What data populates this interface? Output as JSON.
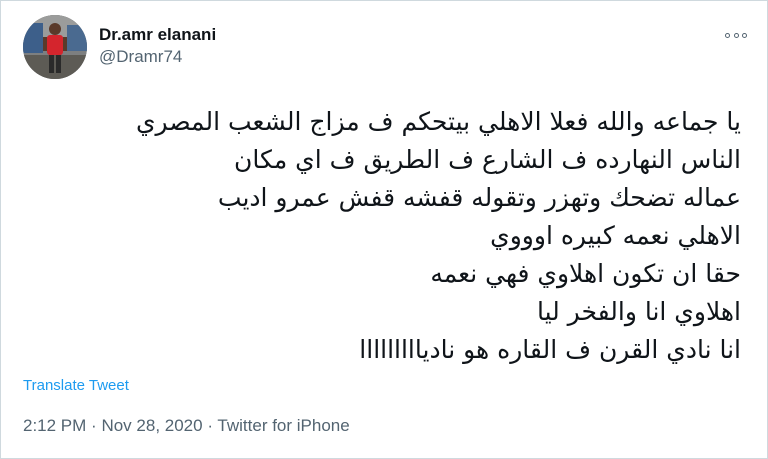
{
  "tweet": {
    "author": {
      "display_name": "Dr.amr elanani",
      "handle": "@Dramr74"
    },
    "more_icon": "more-horizontal-icon",
    "text_lines": [
      "يا جماعه والله فعلا الاهلي بيتحكم ف مزاج الشعب المصري",
      "الناس النهارده  ف الشارع ف الطريق ف اي مكان",
      "عماله تضحك وتهزر وتقوله قفشه قفش عمرو اديب",
      "الاهلي نعمه كبيره اوووي",
      "حقا ان تكون اهلاوي فهي نعمه",
      "اهلاوي انا والفخر ليا",
      "انا نادي القرن ف القاره هو ناديااااااااا"
    ],
    "translate_label": "Translate Tweet",
    "time": "2:12 PM",
    "separator": "·",
    "date": "Nov 28, 2020",
    "source": "Twitter for iPhone"
  },
  "colors": {
    "text": "#0f1419",
    "secondary": "#536471",
    "link": "#1d9bf0",
    "border": "#cfd9de"
  }
}
